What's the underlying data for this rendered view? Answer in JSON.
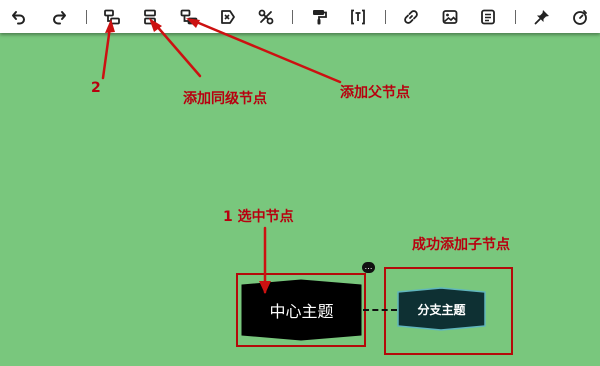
{
  "toolbar": {
    "buttons": [
      {
        "name": "undo-button",
        "icon": "undo-icon"
      },
      {
        "name": "redo-button",
        "icon": "redo-icon"
      },
      {
        "name": "add-child-node-button",
        "icon": "add-child-node-icon"
      },
      {
        "name": "add-sibling-node-button",
        "icon": "add-sibling-node-icon"
      },
      {
        "name": "add-parent-node-button",
        "icon": "add-parent-node-icon"
      },
      {
        "name": "delete-node-button",
        "icon": "delete-node-icon"
      },
      {
        "name": "cut-node-button",
        "icon": "cut-icon"
      },
      {
        "name": "format-painter-button",
        "icon": "format-painter-icon"
      },
      {
        "name": "summary-button",
        "icon": "summary-icon"
      },
      {
        "name": "insert-link-button",
        "icon": "link-icon"
      },
      {
        "name": "insert-image-button",
        "icon": "image-icon"
      },
      {
        "name": "insert-note-button",
        "icon": "note-icon"
      },
      {
        "name": "insert-icon-button",
        "icon": "pin-icon"
      },
      {
        "name": "timer-button",
        "icon": "timer-icon"
      }
    ]
  },
  "annotations": {
    "step2": "2",
    "add_sibling": "添加同级节点",
    "add_parent": "添加父节点",
    "step1": "1 选中节点",
    "success": "成功添加子节点"
  },
  "mindmap": {
    "root_node": "中心主题",
    "child_node": "分支主题",
    "note_badge": "…"
  },
  "colors": {
    "canvas_background": "#79c77d",
    "annotation_red": "#b8000f",
    "root_fill": "#000000",
    "child_fill": "#0e3033",
    "child_stroke": "#60b6bd"
  }
}
